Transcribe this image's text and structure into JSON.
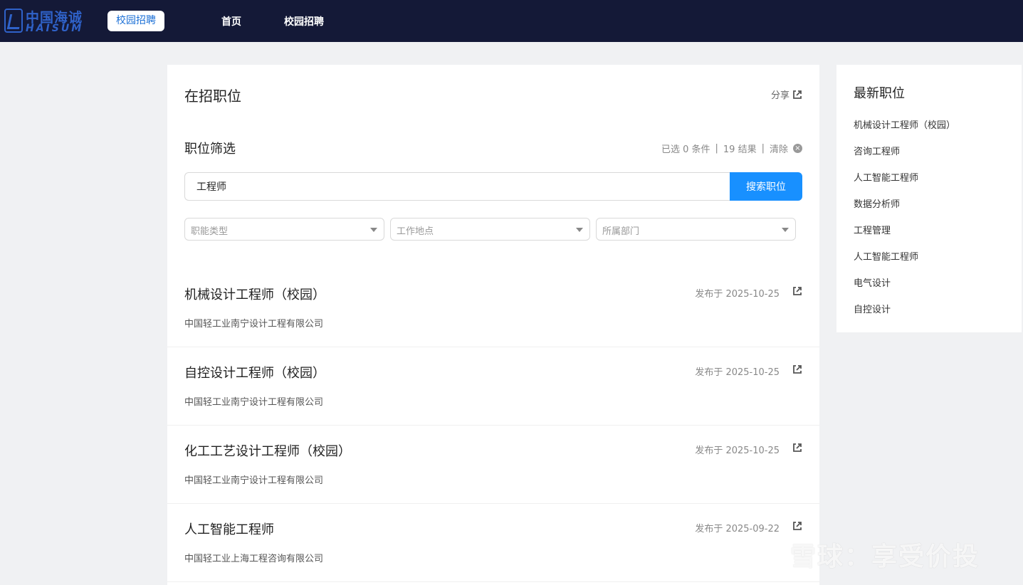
{
  "header": {
    "logo_cn": "中国海诚",
    "logo_en": "HAISUM",
    "campus_tag": "校园招聘",
    "nav": [
      "首页",
      "校园招聘"
    ]
  },
  "main": {
    "title": "在招职位",
    "share_label": "分享",
    "filter": {
      "title": "职位筛选",
      "selected_text": "已选 0 条件",
      "results_text": "19 结果",
      "clear_label": "清除"
    },
    "search": {
      "value": "工程师",
      "button_label": "搜索职位"
    },
    "selects": [
      "职能类型",
      "工作地点",
      "所属部门"
    ],
    "jobs": [
      {
        "title": "机械设计工程师（校园）",
        "date": "发布于 2025-10-25",
        "company": "中国轻工业南宁设计工程有限公司"
      },
      {
        "title": "自控设计工程师（校园）",
        "date": "发布于 2025-10-25",
        "company": "中国轻工业南宁设计工程有限公司"
      },
      {
        "title": "化工工艺设计工程师（校园）",
        "date": "发布于 2025-10-25",
        "company": "中国轻工业南宁设计工程有限公司"
      },
      {
        "title": "人工智能工程师",
        "date": "发布于 2025-09-22",
        "company": "中国轻工业上海工程咨询有限公司"
      }
    ]
  },
  "side": {
    "title": "最新职位",
    "items": [
      "机械设计工程师（校园）",
      "咨询工程师",
      "人工智能工程师",
      "数据分析师",
      "工程管理",
      "人工智能工程师",
      "电气设计",
      "自控设计"
    ]
  },
  "watermark": "雪球：享受价投",
  "colors": {
    "nav_bg": "#141937",
    "accent": "#1890ff",
    "page_bg": "#f0f1f3"
  }
}
